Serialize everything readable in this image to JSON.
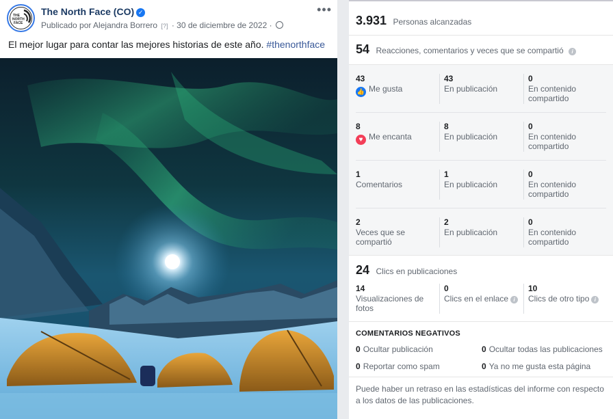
{
  "post": {
    "page_name": "The North Face (CO)",
    "published_by": "Publicado por Alejandra Borrero",
    "help_mark": "[?]",
    "date": "30 de diciembre de 2022",
    "separator": "·",
    "more_label": "•••",
    "caption_text": "El mejor lugar para contar las mejores historias de este año. ",
    "caption_hashtag": "#thenorthface",
    "logo_text_1": "THE",
    "logo_text_2": "NORTH",
    "logo_text_3": "FACE"
  },
  "insights": {
    "reach": {
      "value": "3.931",
      "label": "Personas alcanzadas"
    },
    "reactions_total": {
      "value": "54",
      "label": "Reacciones, comentarios y veces que se compartió"
    },
    "rows": [
      {
        "total": "43",
        "label": "Me gusta",
        "icon": "like-icon",
        "on_post": "43",
        "on_post_label": "En publicación",
        "on_shares": "0",
        "on_shares_label": "En contenido compartido"
      },
      {
        "total": "8",
        "label": "Me encanta",
        "icon": "love-icon",
        "on_post": "8",
        "on_post_label": "En publicación",
        "on_shares": "0",
        "on_shares_label": "En contenido compartido"
      },
      {
        "total": "1",
        "label": "Comentarios",
        "icon": "",
        "on_post": "1",
        "on_post_label": "En publicación",
        "on_shares": "0",
        "on_shares_label": "En contenido compartido"
      },
      {
        "total": "2",
        "label": "Veces que se compartió",
        "icon": "",
        "on_post": "2",
        "on_post_label": "En publicación",
        "on_shares": "0",
        "on_shares_label": "En contenido compartido"
      }
    ],
    "clicks": {
      "value": "24",
      "label": "Clics en publicaciones",
      "photo_views": {
        "value": "14",
        "label": "Visualizaciones de fotos"
      },
      "link_clicks": {
        "value": "0",
        "label": "Clics en el enlace"
      },
      "other_clicks": {
        "value": "10",
        "label": "Clics de otro tipo"
      }
    },
    "negative": {
      "title": "COMENTARIOS NEGATIVOS",
      "items": [
        {
          "value": "0",
          "label": "Ocultar publicación"
        },
        {
          "value": "0",
          "label": "Ocultar todas las publicaciones"
        },
        {
          "value": "0",
          "label": "Reportar como spam"
        },
        {
          "value": "0",
          "label": "Ya no me gusta esta página"
        }
      ]
    },
    "footnote": "Puede haber un retraso en las estadísticas del informe con respecto a los datos de las publicaciones."
  },
  "colors": {
    "brand_blue": "#1877f2",
    "love_red": "#f33e58",
    "hashtag": "#385898",
    "muted_text": "#606770"
  }
}
